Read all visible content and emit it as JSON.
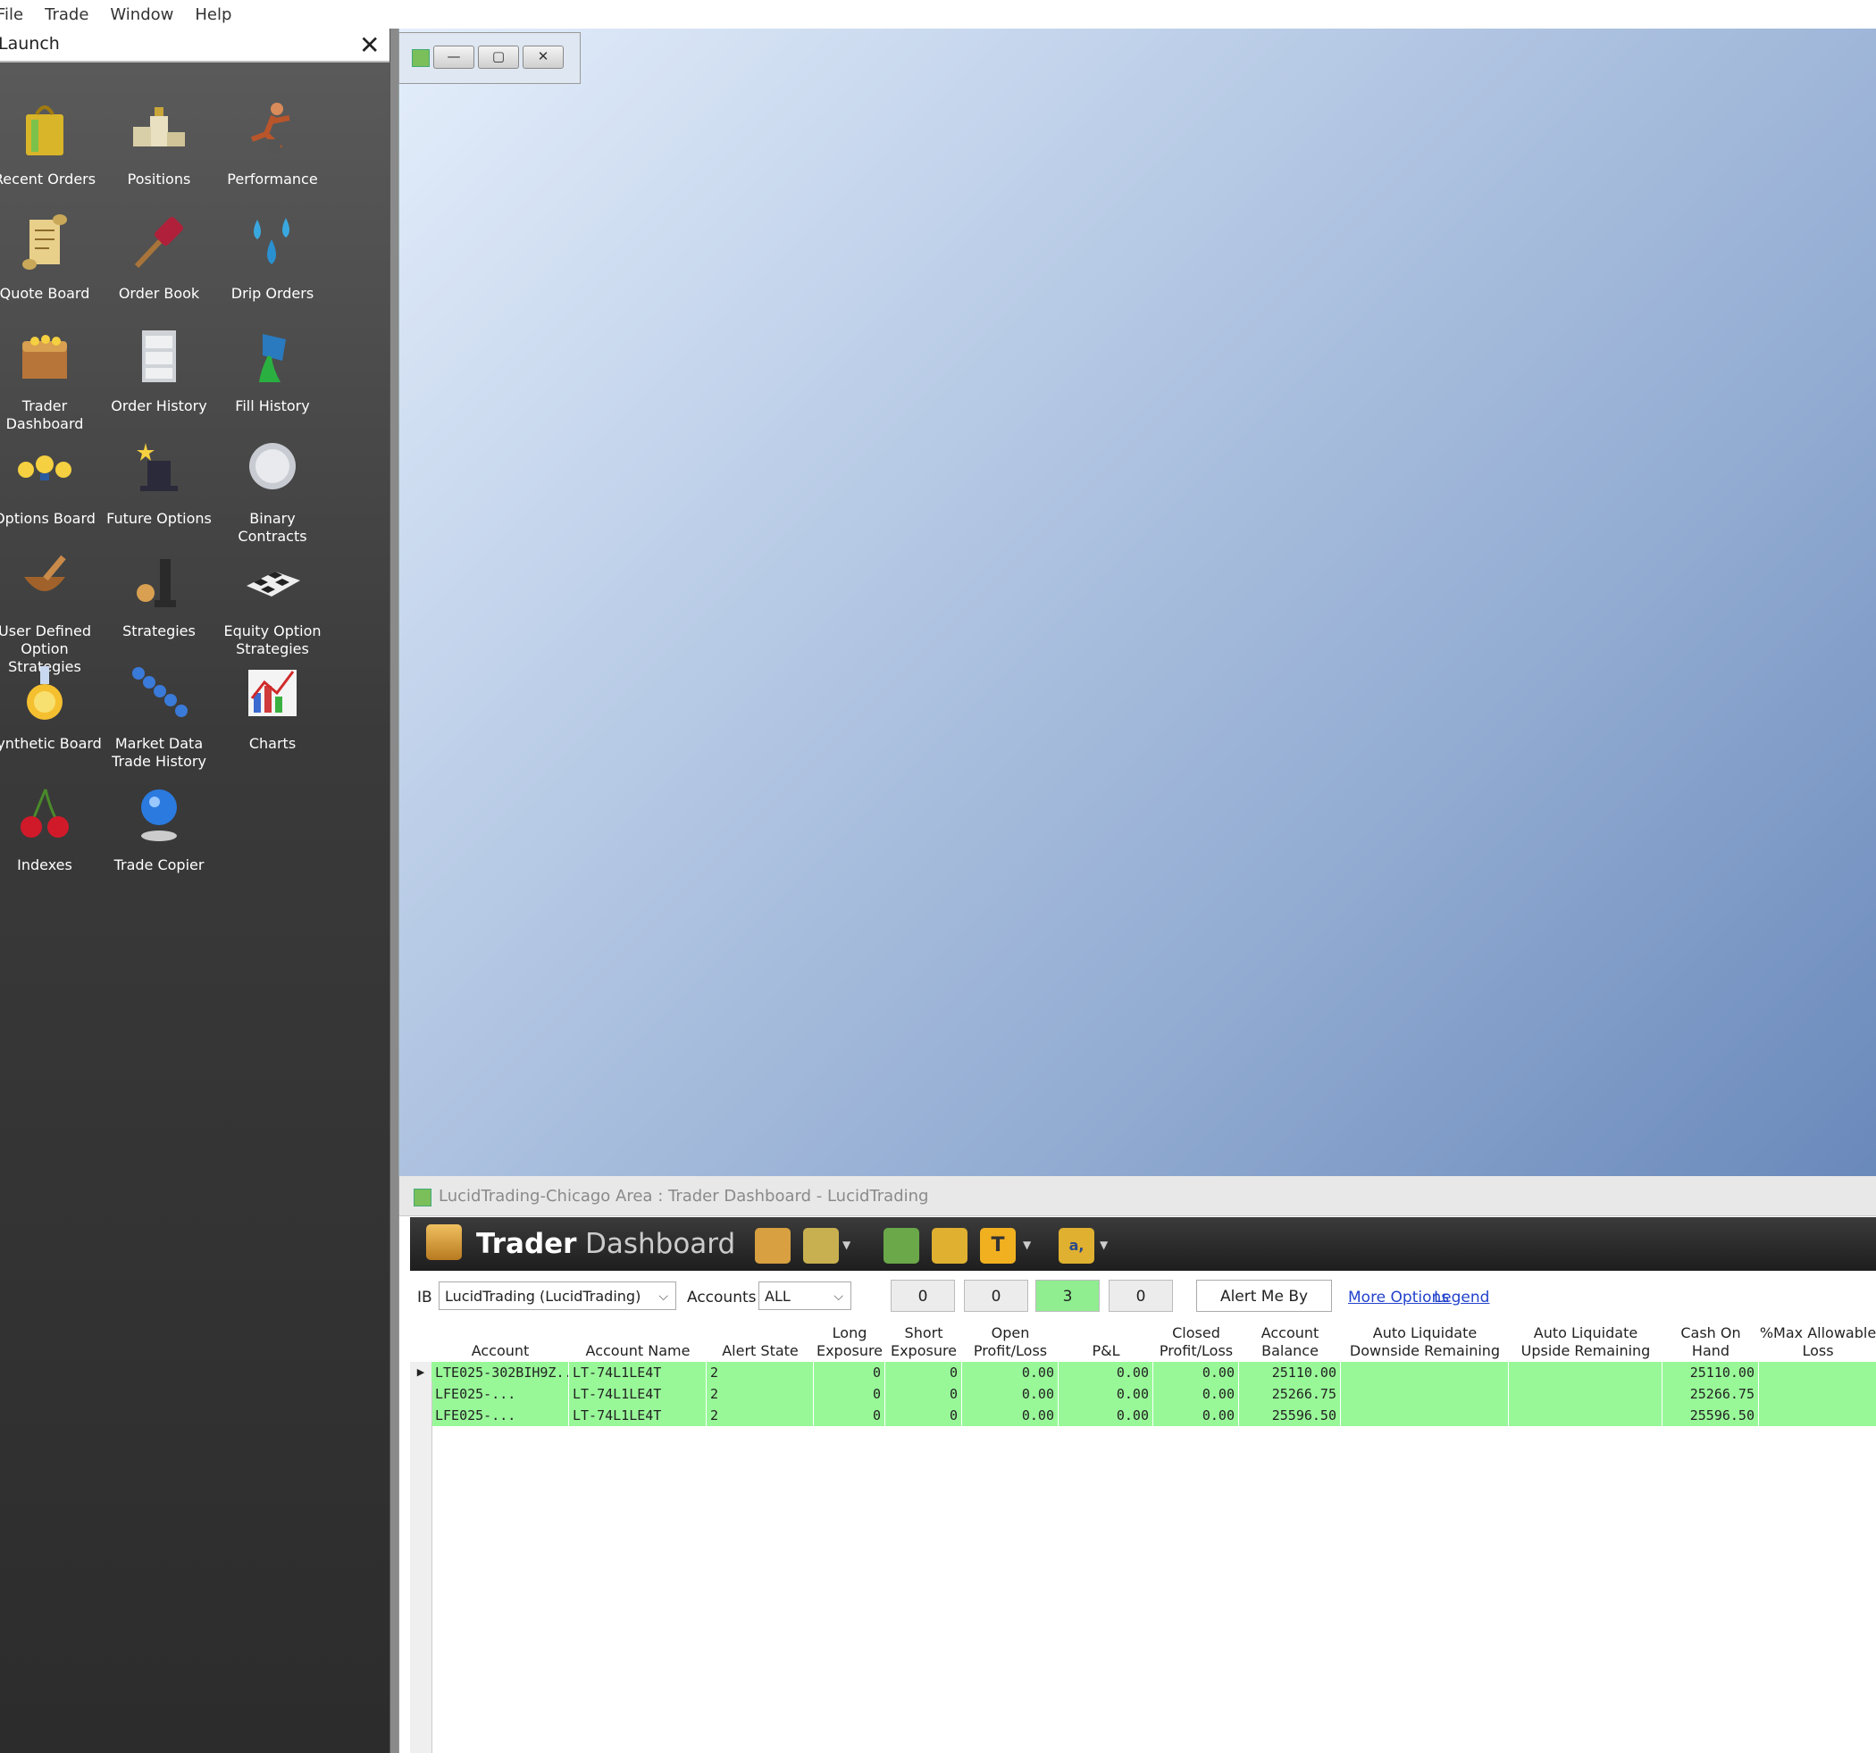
{
  "menu": [
    "File",
    "Trade",
    "Window",
    "Help"
  ],
  "launch": {
    "title": "Launch",
    "close": "✕",
    "tiles": [
      {
        "label": "Recent Orders",
        "icon": "shopping-bag-icon"
      },
      {
        "label": "Positions",
        "icon": "podium-icon"
      },
      {
        "label": "Performance",
        "icon": "runner-icon"
      },
      {
        "label": "Quote Board",
        "icon": "scroll-icon"
      },
      {
        "label": "Order Book",
        "icon": "gavel-icon"
      },
      {
        "label": "Drip Orders",
        "icon": "water-drops-icon"
      },
      {
        "label": "Trader Dashboard",
        "icon": "treasure-chest-icon"
      },
      {
        "label": "Order History",
        "icon": "file-cabinet-icon"
      },
      {
        "label": "Fill History",
        "icon": "paint-bucket-icon"
      },
      {
        "label": "Options Board",
        "icon": "lightbulbs-icon"
      },
      {
        "label": "Future Options",
        "icon": "magic-hat-icon"
      },
      {
        "label": "Binary Contracts",
        "icon": "coin-icon"
      },
      {
        "label": "User Defined Option Strategies",
        "icon": "mortar-pestle-icon"
      },
      {
        "label": "Strategies",
        "icon": "chess-pieces-icon"
      },
      {
        "label": "Equity Option Strategies",
        "icon": "chess-board-icon"
      },
      {
        "label": "Synthetic Board",
        "icon": "flask-icon"
      },
      {
        "label": "Market Data Trade History",
        "icon": "beads-icon"
      },
      {
        "label": "Charts",
        "icon": "chart-icon"
      },
      {
        "label": "Indexes",
        "icon": "cherries-icon"
      },
      {
        "label": "Trade Copier",
        "icon": "person-globe-icon"
      }
    ]
  },
  "minwin": {
    "min": "—",
    "max": "▢",
    "close": "✕"
  },
  "dashboard": {
    "title": "LucidTrading-Chicago Area : Trader Dashboard - LucidTrading",
    "brand1": "Trader",
    "brand2": "Dashboard",
    "ib_label": "IB",
    "ib_value": "LucidTrading (LucidTrading)",
    "accounts_label": "Accounts",
    "accounts_value": "ALL",
    "counts": [
      "0",
      "0",
      "3",
      "0"
    ],
    "alert_btn": "Alert Me By",
    "more": "More Options",
    "legend": "Legend",
    "toolbar_t": "T",
    "toolbar_a": "a,",
    "columns": [
      "Account",
      "Account Name",
      "Alert State",
      "Long Exposure",
      "Short Exposure",
      "Open Profit/Loss",
      "P&L",
      "Closed Profit/Loss",
      "Account Balance",
      "Auto Liquidate Downside Remaining",
      "Auto Liquidate Upside Remaining",
      "Cash On Hand",
      "%Max Allowable Loss"
    ],
    "rows": [
      {
        "account": "LTE025-302BIH9Z...",
        "name": "LT-74L1LE4T",
        "alert": "2",
        "long": "0",
        "short": "0",
        "open": "0.00",
        "pl": "0.00",
        "closed": "0.00",
        "balance": "25110.00",
        "down": "",
        "up": "",
        "cash": "25110.00",
        "maxloss": ""
      },
      {
        "account": "LFE025-...",
        "name": "LT-74L1LE4T",
        "alert": "2",
        "long": "0",
        "short": "0",
        "open": "0.00",
        "pl": "0.00",
        "closed": "0.00",
        "balance": "25266.75",
        "down": "",
        "up": "",
        "cash": "25266.75",
        "maxloss": ""
      },
      {
        "account": "LFE025-...",
        "name": "LT-74L1LE4T",
        "alert": "2",
        "long": "0",
        "short": "0",
        "open": "0.00",
        "pl": "0.00",
        "closed": "0.00",
        "balance": "25596.50",
        "down": "",
        "up": "",
        "cash": "25596.50",
        "maxloss": ""
      }
    ]
  },
  "colors": {
    "row_green": "#98f898",
    "count_green": "#90ee90",
    "link": "#2242cc"
  }
}
